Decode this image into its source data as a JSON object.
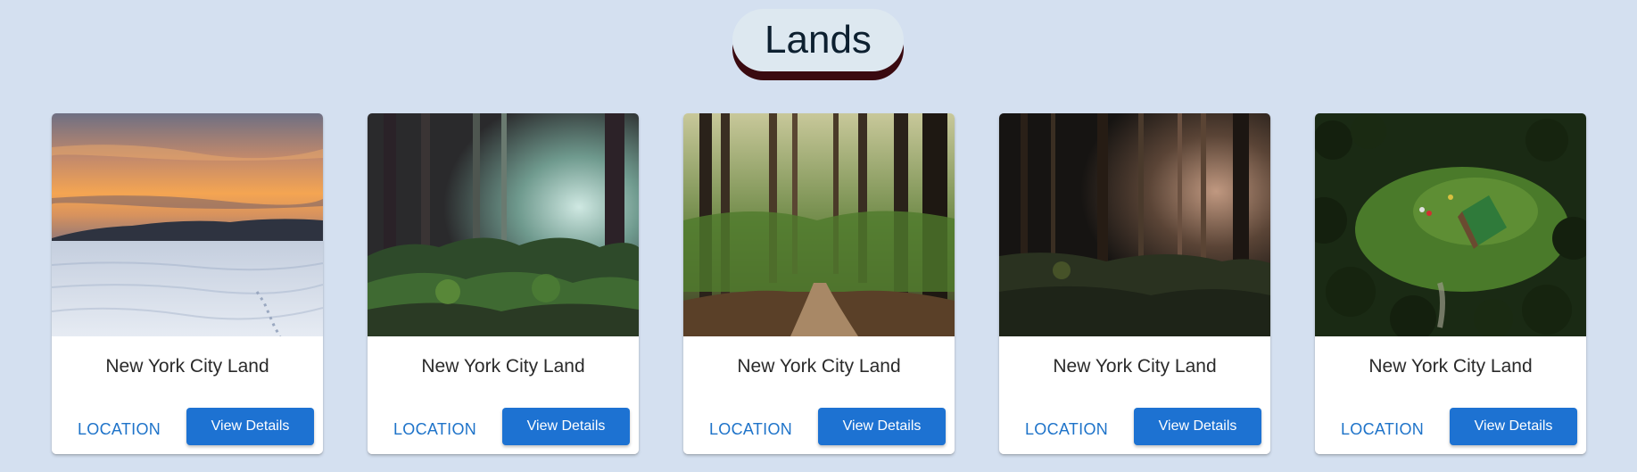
{
  "header": {
    "title": "Lands"
  },
  "cards": [
    {
      "name": "New York City Land",
      "location_label": "LOCATION",
      "button_label": "View Details",
      "image": "snowy-lake-sunset"
    },
    {
      "name": "New York City Land",
      "location_label": "LOCATION",
      "button_label": "View Details",
      "image": "misty-forest"
    },
    {
      "name": "New York City Land",
      "location_label": "LOCATION",
      "button_label": "View Details",
      "image": "forest-path"
    },
    {
      "name": "New York City Land",
      "location_label": "LOCATION",
      "button_label": "View Details",
      "image": "dark-forest"
    },
    {
      "name": "New York City Land",
      "location_label": "LOCATION",
      "button_label": "View Details",
      "image": "aerial-cabin-clearing"
    }
  ],
  "colors": {
    "background": "#d4e0f0",
    "accent": "#1d72d2",
    "title_shadow": "#3a0a10"
  }
}
